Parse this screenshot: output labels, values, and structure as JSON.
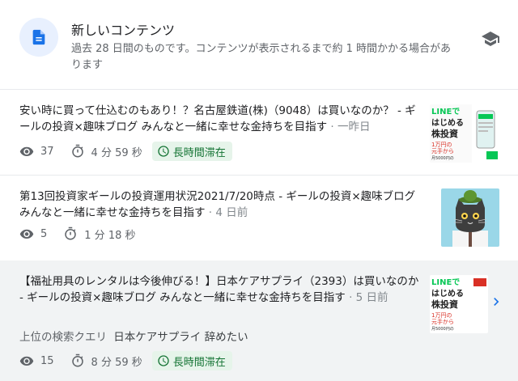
{
  "header": {
    "title": "新しいコンテンツ",
    "description": "過去 28 日間のものです。コンテンツが表示されるまで約 1 時間かかる場合があります",
    "icon": "document-icon",
    "learn_icon": "school-icon"
  },
  "items": [
    {
      "title": "安い時に買って仕込むのもあり！？名古屋鉄道(株)（9048）は買いなのか？ - ギールの投資×趣味ブログ みんなと一緒に幸せな金持ちを目指す",
      "date": "一昨日",
      "views": "37",
      "duration": "4 分 59 秒",
      "badge": "長時間滞在",
      "thumb_text": [
        "LINEで",
        "はじめる",
        "株投資",
        "1万円の",
        "元手から",
        "月5000円の",
        "配当を目指す"
      ]
    },
    {
      "title": "第13回投資家ギールの投資運用状況2021/7/20時点 - ギールの投資×趣味ブログ みんなと一緒に幸せな金持ちを目指す",
      "date": "4 日前",
      "views": "5",
      "duration": "1 分 18 秒"
    },
    {
      "title": "【福祉用具のレンタルは今後伸びる！】日本ケアサプライ（2393）は買いなのか - ギールの投資×趣味ブログ みんなと一緒に幸せな金持ちを目指す",
      "date": "5 日前",
      "query_label": "上位の検索クエリ",
      "query_value": "日本ケアサプライ 辞めたい",
      "views": "15",
      "duration": "8 分 59 秒",
      "badge": "長時間滞在",
      "thumb_text": [
        "LINEで",
        "はじめる",
        "株投資",
        "1万円の",
        "元手から",
        "月5000円の",
        "配当を目指す"
      ]
    }
  ],
  "icons": {
    "views": "eye-icon",
    "duration": "stopwatch-icon",
    "badge": "clock-icon",
    "next": "chevron-right-icon"
  },
  "colors": {
    "accent": "#1a73e8",
    "badge_bg": "#e6f4ea",
    "badge_text": "#137333",
    "highlight_bg": "#f1f3f4"
  }
}
